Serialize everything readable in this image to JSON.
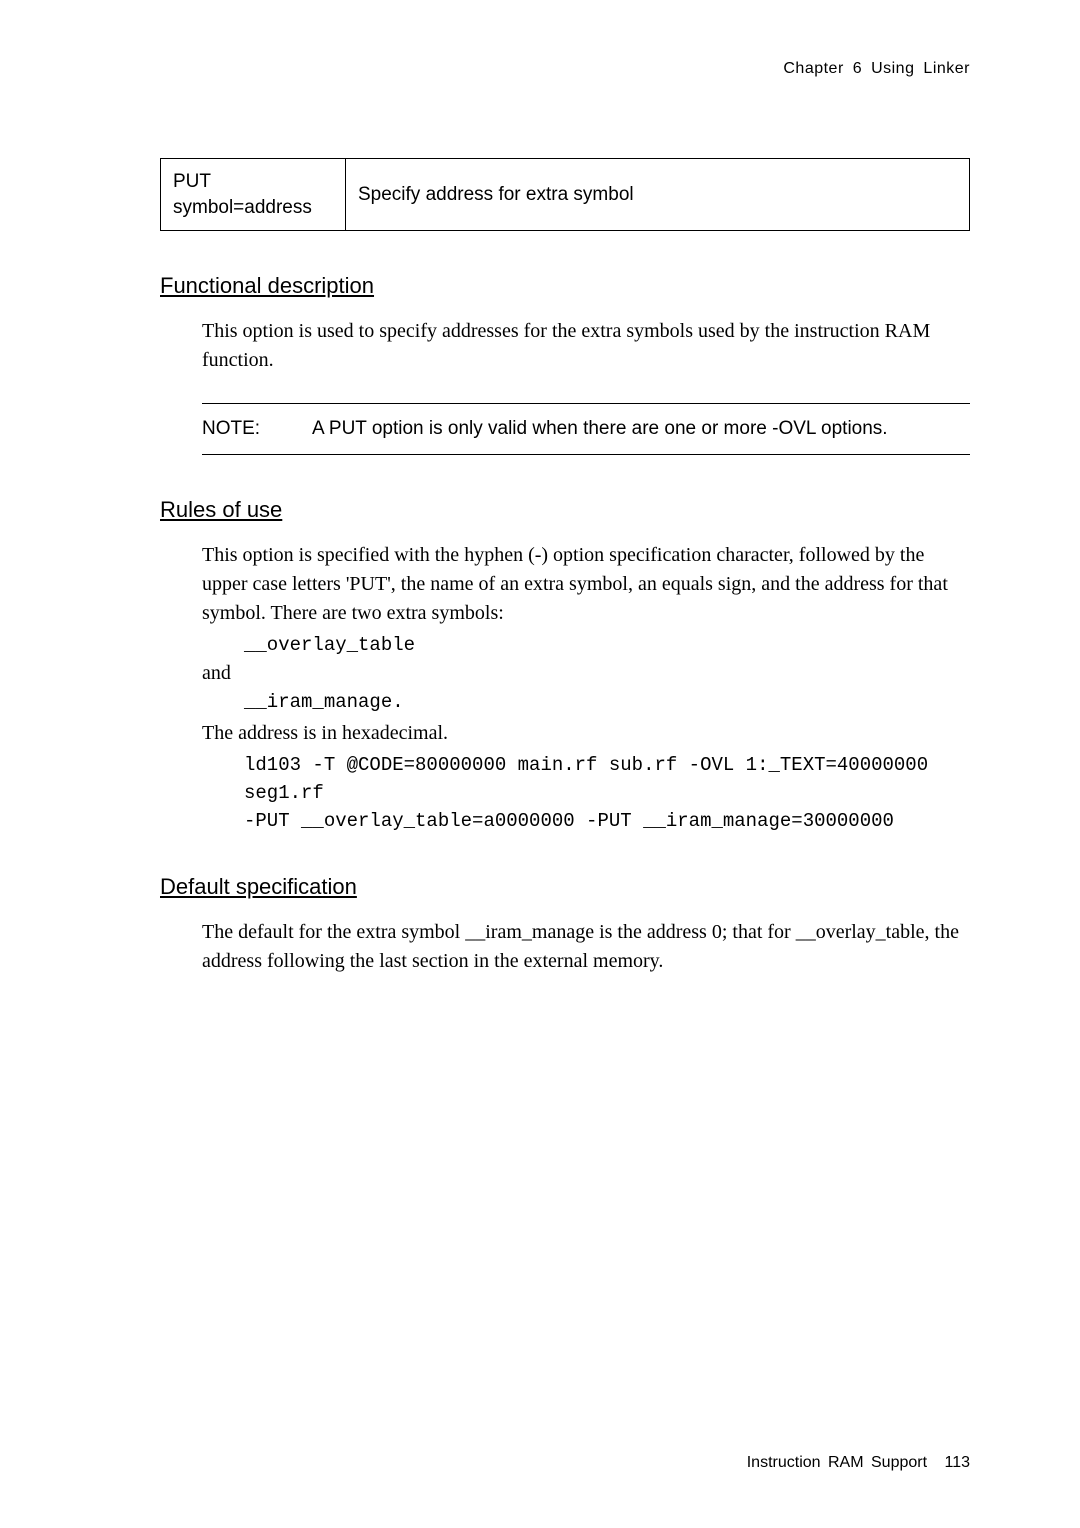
{
  "header": {
    "running": "Chapter  6   Using Linker"
  },
  "option_table": {
    "left_line1": "PUT",
    "left_line2": "symbol=address",
    "right": "Specify address for extra symbol"
  },
  "sections": {
    "functional": {
      "heading": "Functional description",
      "p1": "This option is used to specify addresses for the extra symbols used by the instruction RAM function.",
      "note_label": "NOTE:",
      "note_text": "A PUT option is only valid when there are one or more -OVL options."
    },
    "rules": {
      "heading": "Rules of use",
      "p1": "This option is specified with the hyphen (-) option specification character, followed by the upper case letters 'PUT', the name of an extra symbol, an equals sign, and the address for that symbol. There are two extra symbols:",
      "sym1": "__overlay_table",
      "and": "and",
      "sym2": "__iram_manage.",
      "p2": "The address is in hexadecimal.",
      "cmd1": "ld103 -T @CODE=80000000 main.rf sub.rf -OVL 1:_TEXT=40000000",
      "cmd2": "seg1.rf",
      "cmd3": "-PUT __overlay_table=a0000000 -PUT __iram_manage=30000000"
    },
    "default": {
      "heading": "Default specification",
      "p1": "The default for the extra symbol __iram_manage is the address 0; that for __overlay_table, the address following the last section in the external memory."
    }
  },
  "footer": {
    "label": "Instruction RAM Support",
    "page": "113"
  }
}
